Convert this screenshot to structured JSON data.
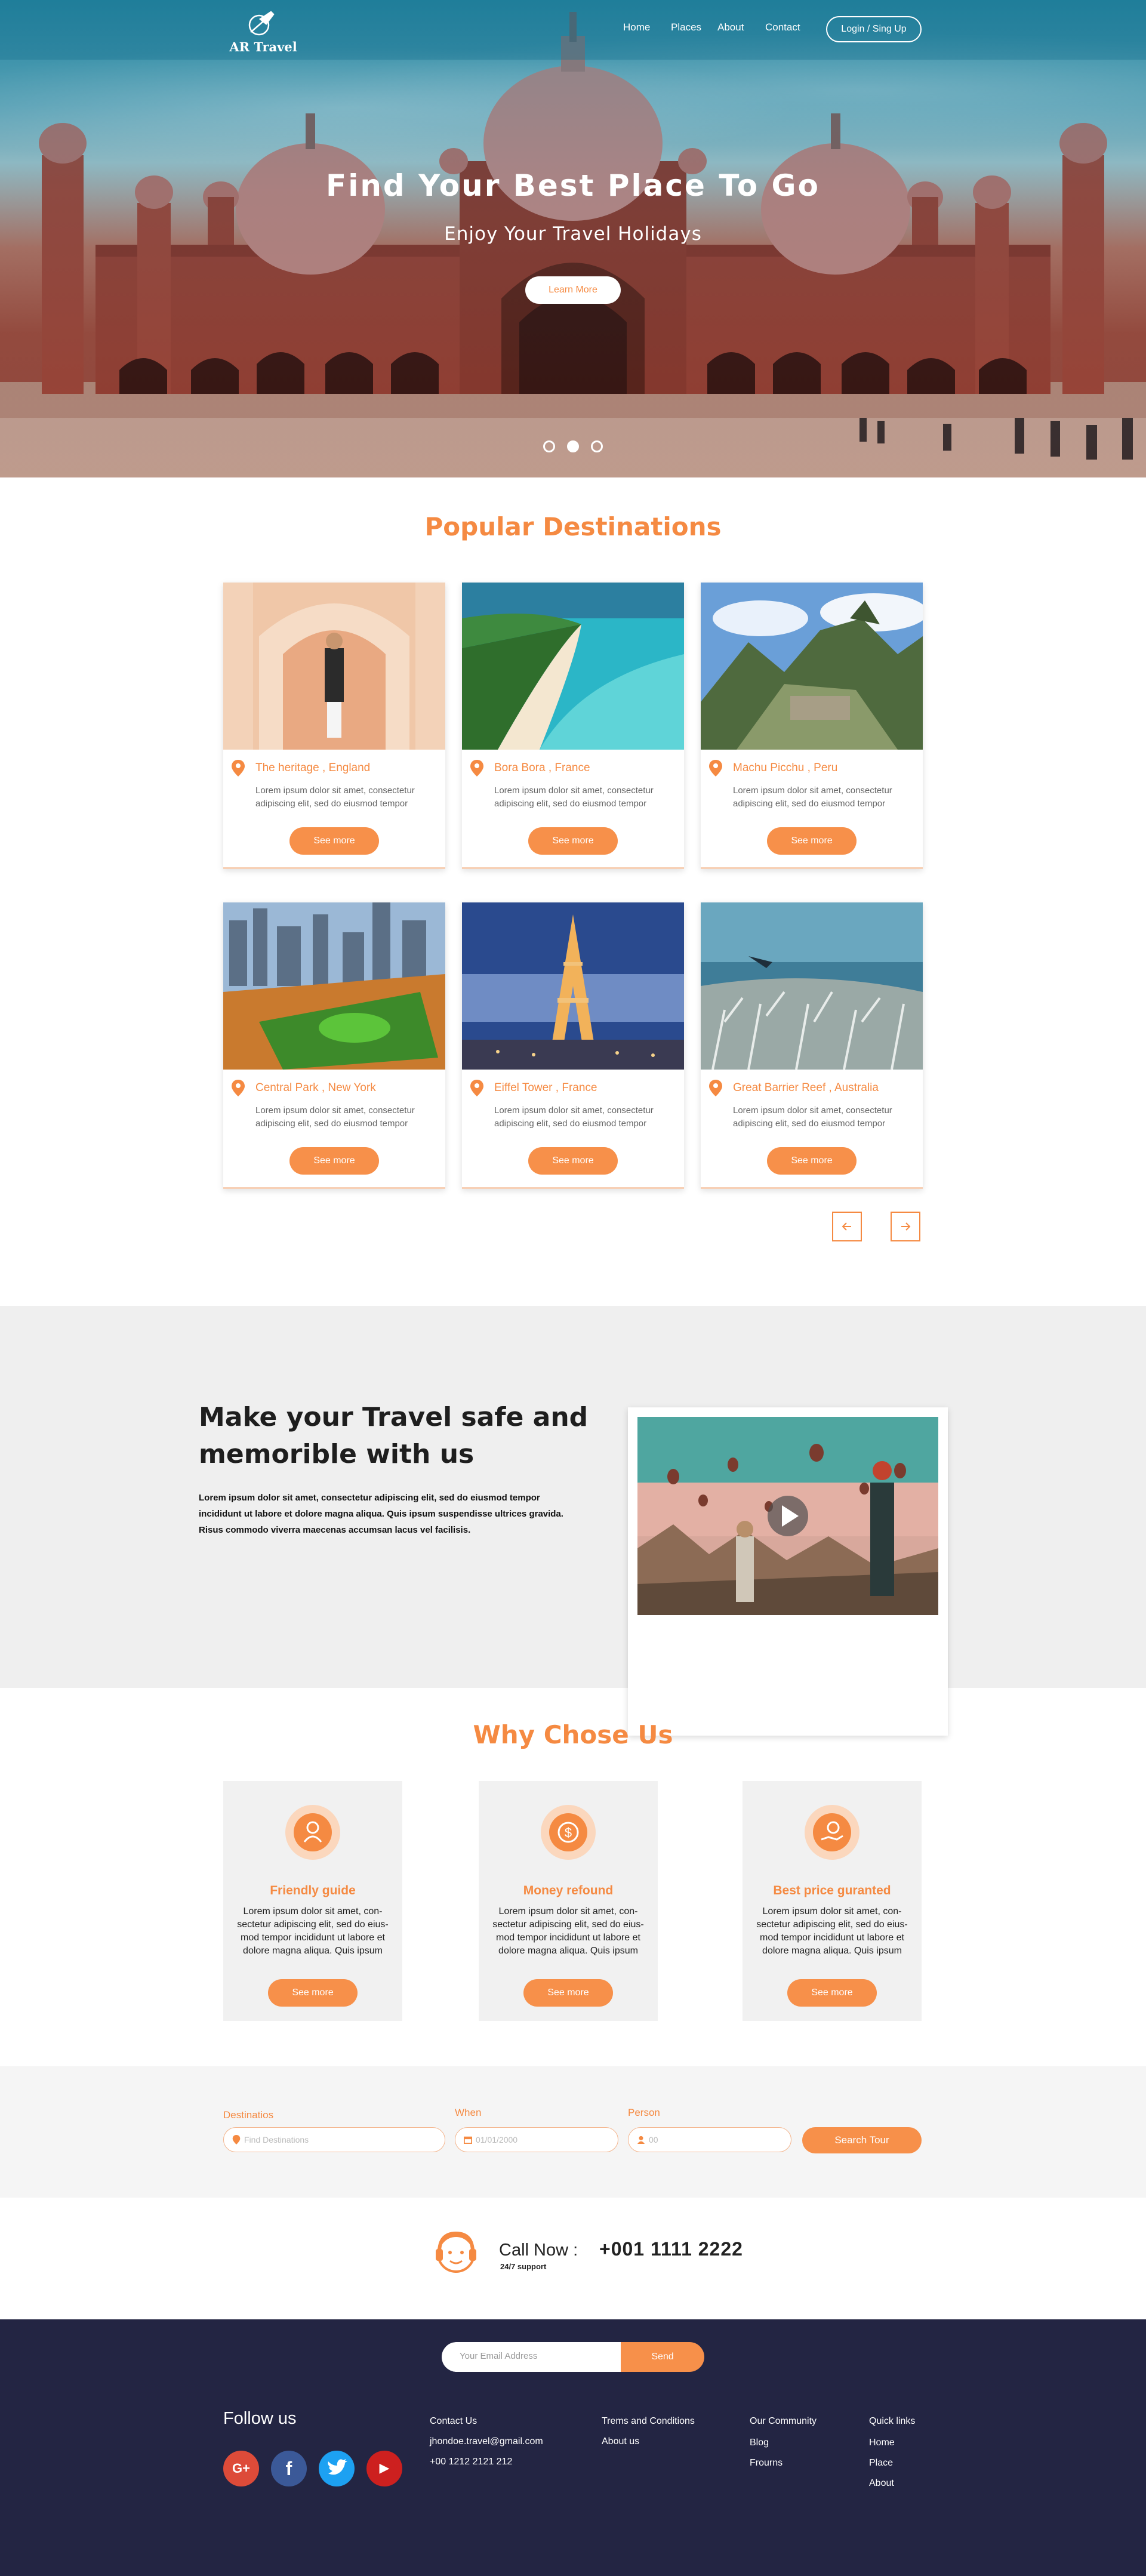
{
  "brand": {
    "name": "AR Travel"
  },
  "nav": {
    "items": [
      {
        "label": "Home"
      },
      {
        "label": "Places"
      },
      {
        "label": "About"
      },
      {
        "label": "Contact"
      }
    ],
    "login_label": "Login / Sing Up"
  },
  "hero": {
    "title": "Find Your Best Place To Go",
    "subtitle": "Enjoy Your Travel Holidays",
    "cta_label": "Learn More",
    "slides": 3,
    "active_slide": 2
  },
  "popular": {
    "title": "Popular Destinations",
    "description": "Lorem ipsum dolor sit amet, consectetur adipiscing elit, sed do eiusmod tempor",
    "button_label": "See more",
    "cards": [
      {
        "place": "The heritage , England",
        "image": "arched-palace-woman"
      },
      {
        "place": "Bora Bora , France",
        "image": "tropical-island-beach"
      },
      {
        "place": "Machu Picchu , Peru",
        "image": "mountain-ruins"
      },
      {
        "place": "Central Park , New York",
        "image": "city-park-aerial"
      },
      {
        "place": "Eiffel Tower , France",
        "image": "eiffel-tower-night"
      },
      {
        "place": "Great Barrier Reef , Australia",
        "image": "coral-reef-diver"
      }
    ],
    "prev_icon": "arrow-left-icon",
    "next_icon": "arrow-right-icon"
  },
  "safe": {
    "title_line1": "Make your Travel safe and",
    "title_line2": "memorible with us",
    "text": "Lorem ipsum dolor sit amet, consectetur adipiscing elit, sed do eiusmod tempor incididunt ut labore et dolore magna aliqua. Quis ipsum suspendisse ultrices gravida. Risus commodo viverra maecenas accumsan lacus vel facilisis."
  },
  "why": {
    "title": "Why Chose Us",
    "button_label": "See more",
    "description": "Lorem ipsum dolor sit amet, con-sectetur adipiscing elit, sed do eius-mod tempor incididunt ut labore et dolore magna aliqua. Quis ipsum",
    "cards": [
      {
        "title": "Friendly guide",
        "icon": "guide-icon"
      },
      {
        "title": "Money refound",
        "icon": "dollar-coin-icon"
      },
      {
        "title": "Best price guranted",
        "icon": "price-hand-icon"
      }
    ]
  },
  "search": {
    "destination_label": "Destinatios",
    "destination_placeholder": "Find Destinations",
    "when_label": "When",
    "when_placeholder": "01/01/2000",
    "person_label": "Person",
    "person_placeholder": "00",
    "button_label": "Search Tour"
  },
  "call": {
    "title": "Call Now :",
    "subtitle": "24/7 support",
    "number": "+001 1111 2222"
  },
  "footer": {
    "email_placeholder": "Your Email Address",
    "send_label": "Send",
    "follow_title": "Follow us",
    "social": [
      {
        "name": "google-plus",
        "glyph": "G+",
        "color": "#dd4b39"
      },
      {
        "name": "facebook",
        "glyph": "f",
        "color": "#3b5998"
      },
      {
        "name": "twitter",
        "glyph": "t",
        "color": "#1da1f2"
      },
      {
        "name": "youtube",
        "glyph": "▶",
        "color": "#cd201f"
      }
    ],
    "contact": {
      "title": "Contact Us",
      "email": "jhondoe.travel@gmail.com",
      "phone": "+00 1212 2121 212"
    },
    "terms": {
      "title": "Trems  and Conditions",
      "about": "About us"
    },
    "community": {
      "title": "Our Community",
      "blog": "Blog",
      "forums": "Frourns"
    },
    "quick": {
      "title": "Quick links",
      "home": "Home",
      "place": "Place",
      "about": "About"
    }
  },
  "colors": {
    "accent": "#f58a42",
    "footer_bg": "#232543",
    "section_gray": "#efefef"
  }
}
